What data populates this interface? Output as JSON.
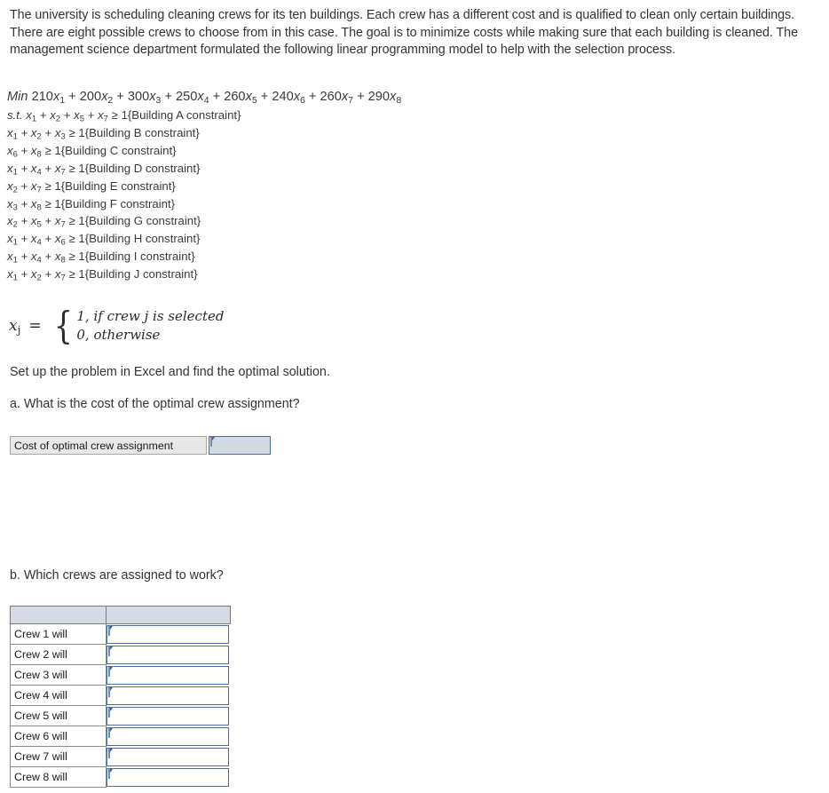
{
  "intro": {
    "paragraph": "The university is scheduling cleaning crews for its ten buildings. Each crew has a different cost and is qualified to clean only certain buildings. There are eight possible crews to choose from in this case. The goal is to minimize costs while making sure that each building is cleaned. The management science department formulated the following linear programming model to help with the selection process."
  },
  "model": {
    "objective": {
      "keyword": "Min",
      "terms": [
        {
          "coef": "210",
          "var": "x",
          "sub": "1"
        },
        {
          "coef": "200",
          "var": "x",
          "sub": "2"
        },
        {
          "coef": "300",
          "var": "x",
          "sub": "3"
        },
        {
          "coef": "250",
          "var": "x",
          "sub": "4"
        },
        {
          "coef": "260",
          "var": "x",
          "sub": "5"
        },
        {
          "coef": "240",
          "var": "x",
          "sub": "6"
        },
        {
          "coef": "260",
          "var": "x",
          "sub": "7"
        },
        {
          "coef": "290",
          "var": "x",
          "sub": "8"
        }
      ]
    },
    "st_keyword": "s.t.",
    "relation": "≥",
    "rhs": "1",
    "constraints": [
      {
        "vars": [
          "1",
          "2",
          "5",
          "7"
        ],
        "label": "{Building A constraint}"
      },
      {
        "vars": [
          "1",
          "2",
          "3"
        ],
        "label": "{Building B constraint}"
      },
      {
        "vars": [
          "6",
          "8"
        ],
        "label": "{Building C constraint}"
      },
      {
        "vars": [
          "1",
          "4",
          "7"
        ],
        "label": "{Building D constraint}"
      },
      {
        "vars": [
          "2",
          "7"
        ],
        "label": "{Building E constraint}"
      },
      {
        "vars": [
          "3",
          "8"
        ],
        "label": "{Building F constraint}"
      },
      {
        "vars": [
          "2",
          "5",
          "7"
        ],
        "label": "{Building G constraint}"
      },
      {
        "vars": [
          "1",
          "4",
          "6"
        ],
        "label": "{Building H constraint}"
      },
      {
        "vars": [
          "1",
          "4",
          "8"
        ],
        "label": "{Building I constraint}"
      },
      {
        "vars": [
          "1",
          "2",
          "7"
        ],
        "label": "{Building J constraint}"
      }
    ],
    "binary_definition": {
      "variable": "x",
      "variable_sub": "j",
      "equals": "=",
      "case_one": "1, if crew j is selected",
      "case_zero": "0, otherwise"
    }
  },
  "prose": {
    "setup_line": "Set up the problem in Excel and find the optimal solution.",
    "question_a": "a. What is the cost of the optimal crew assignment?",
    "question_b": "b. Which crews are assigned to work?"
  },
  "answer_a": {
    "label": "Cost of optimal crew assignment",
    "value": "",
    "placeholder": ""
  },
  "crew_table": {
    "headers": [
      "",
      ""
    ],
    "rows": [
      {
        "label": "Crew 1 will",
        "value": "",
        "placeholder": ""
      },
      {
        "label": "Crew 2 will",
        "value": "",
        "placeholder": ""
      },
      {
        "label": "Crew 3 will",
        "value": "",
        "placeholder": ""
      },
      {
        "label": "Crew 4 will",
        "value": "",
        "placeholder": ""
      },
      {
        "label": "Crew 5 will",
        "value": "",
        "placeholder": ""
      },
      {
        "label": "Crew 6 will",
        "value": "",
        "placeholder": ""
      },
      {
        "label": "Crew 7 will",
        "value": "",
        "placeholder": ""
      },
      {
        "label": "Crew 8 will",
        "value": "",
        "placeholder": ""
      }
    ]
  },
  "colors": {
    "text": "#333333",
    "input_border": "#4d6f9e",
    "input_fill_a": "#d4dae4",
    "input_fill_table": "#ffffff",
    "table_header_fill": "#d6dbe3",
    "label_cell_fill": "#e8e8e8",
    "flag_marker": "#3f5f8f"
  }
}
